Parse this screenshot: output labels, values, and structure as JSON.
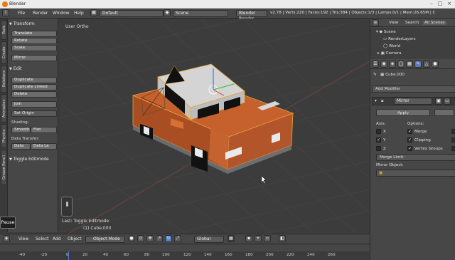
{
  "window": {
    "title": "Blender"
  },
  "info_bar": {
    "menus": [
      "File",
      "Render",
      "Window",
      "Help"
    ],
    "screen_layout": "Default",
    "scene": "Scene",
    "render_engine": "Blender Render",
    "stats": "v2.78 | Verts:220 | Faces:192 | Tris:384 | Objects:1/3 | Lamps:0/1 | Mem:26.65M | C"
  },
  "left_tabs": [
    "Tools",
    "Create",
    "Relations",
    "Animation",
    "Physics",
    "Grease Pencil"
  ],
  "tool_shelf": {
    "transform_header": "Transform",
    "transform_buttons": [
      "Translate",
      "Rotate",
      "Scale",
      "Mirror"
    ],
    "edit_header": "Edit",
    "edit_buttons": [
      "Duplicate",
      "Duplicate Linked",
      "Delete",
      "Join"
    ],
    "set_origin": "Set Origin",
    "shading_label": "Shading:",
    "shading_smooth": "Smooth",
    "shading_flat": "Flat",
    "data_transfer_label": "Data Transfer:",
    "data_btn": "Data",
    "data_layout_btn": "Data La",
    "toggle_editmode": "Toggle Editmode"
  },
  "viewport": {
    "view_label": "User Ortho",
    "last_op": "Last: Toggle Editmode",
    "object_label": "(1) Cube.000",
    "pause": "Pause"
  },
  "viewport_header": {
    "menus": [
      "View",
      "Select",
      "Add",
      "Object"
    ],
    "mode": "Object Mode",
    "orientation": "Global"
  },
  "timeline": {
    "ticks": [
      "-40",
      "-20",
      "0",
      "20",
      "40",
      "60",
      "80",
      "100",
      "120",
      "140",
      "160",
      "180",
      "200",
      "220",
      "240",
      "260"
    ]
  },
  "outliner": {
    "tabs": [
      "View",
      "Search",
      "All Scenes"
    ],
    "items": [
      "Scene",
      "RenderLayers",
      "World",
      "Camera"
    ]
  },
  "properties": {
    "object_name": "Cube.000",
    "add_modifier": "Add Modifier",
    "modifier_name": "Mirror",
    "apply": "Apply",
    "axis_label": "Axis:",
    "options_label": "Options:",
    "axes": [
      "X",
      "Y",
      "Z"
    ],
    "axes_checked": [
      false,
      true,
      false
    ],
    "options": [
      "Merge",
      "Clipping",
      "Vertex Groups"
    ],
    "options_checked": [
      true,
      true,
      true
    ],
    "merge_limit": "Merge Limit:",
    "mirror_object": "Mirror Object:"
  },
  "colors": {
    "car_body": "#c8622f",
    "car_cabin": "#d9d9d9",
    "selection_outline": "#e8a23a",
    "background": "#3c3c3c"
  }
}
